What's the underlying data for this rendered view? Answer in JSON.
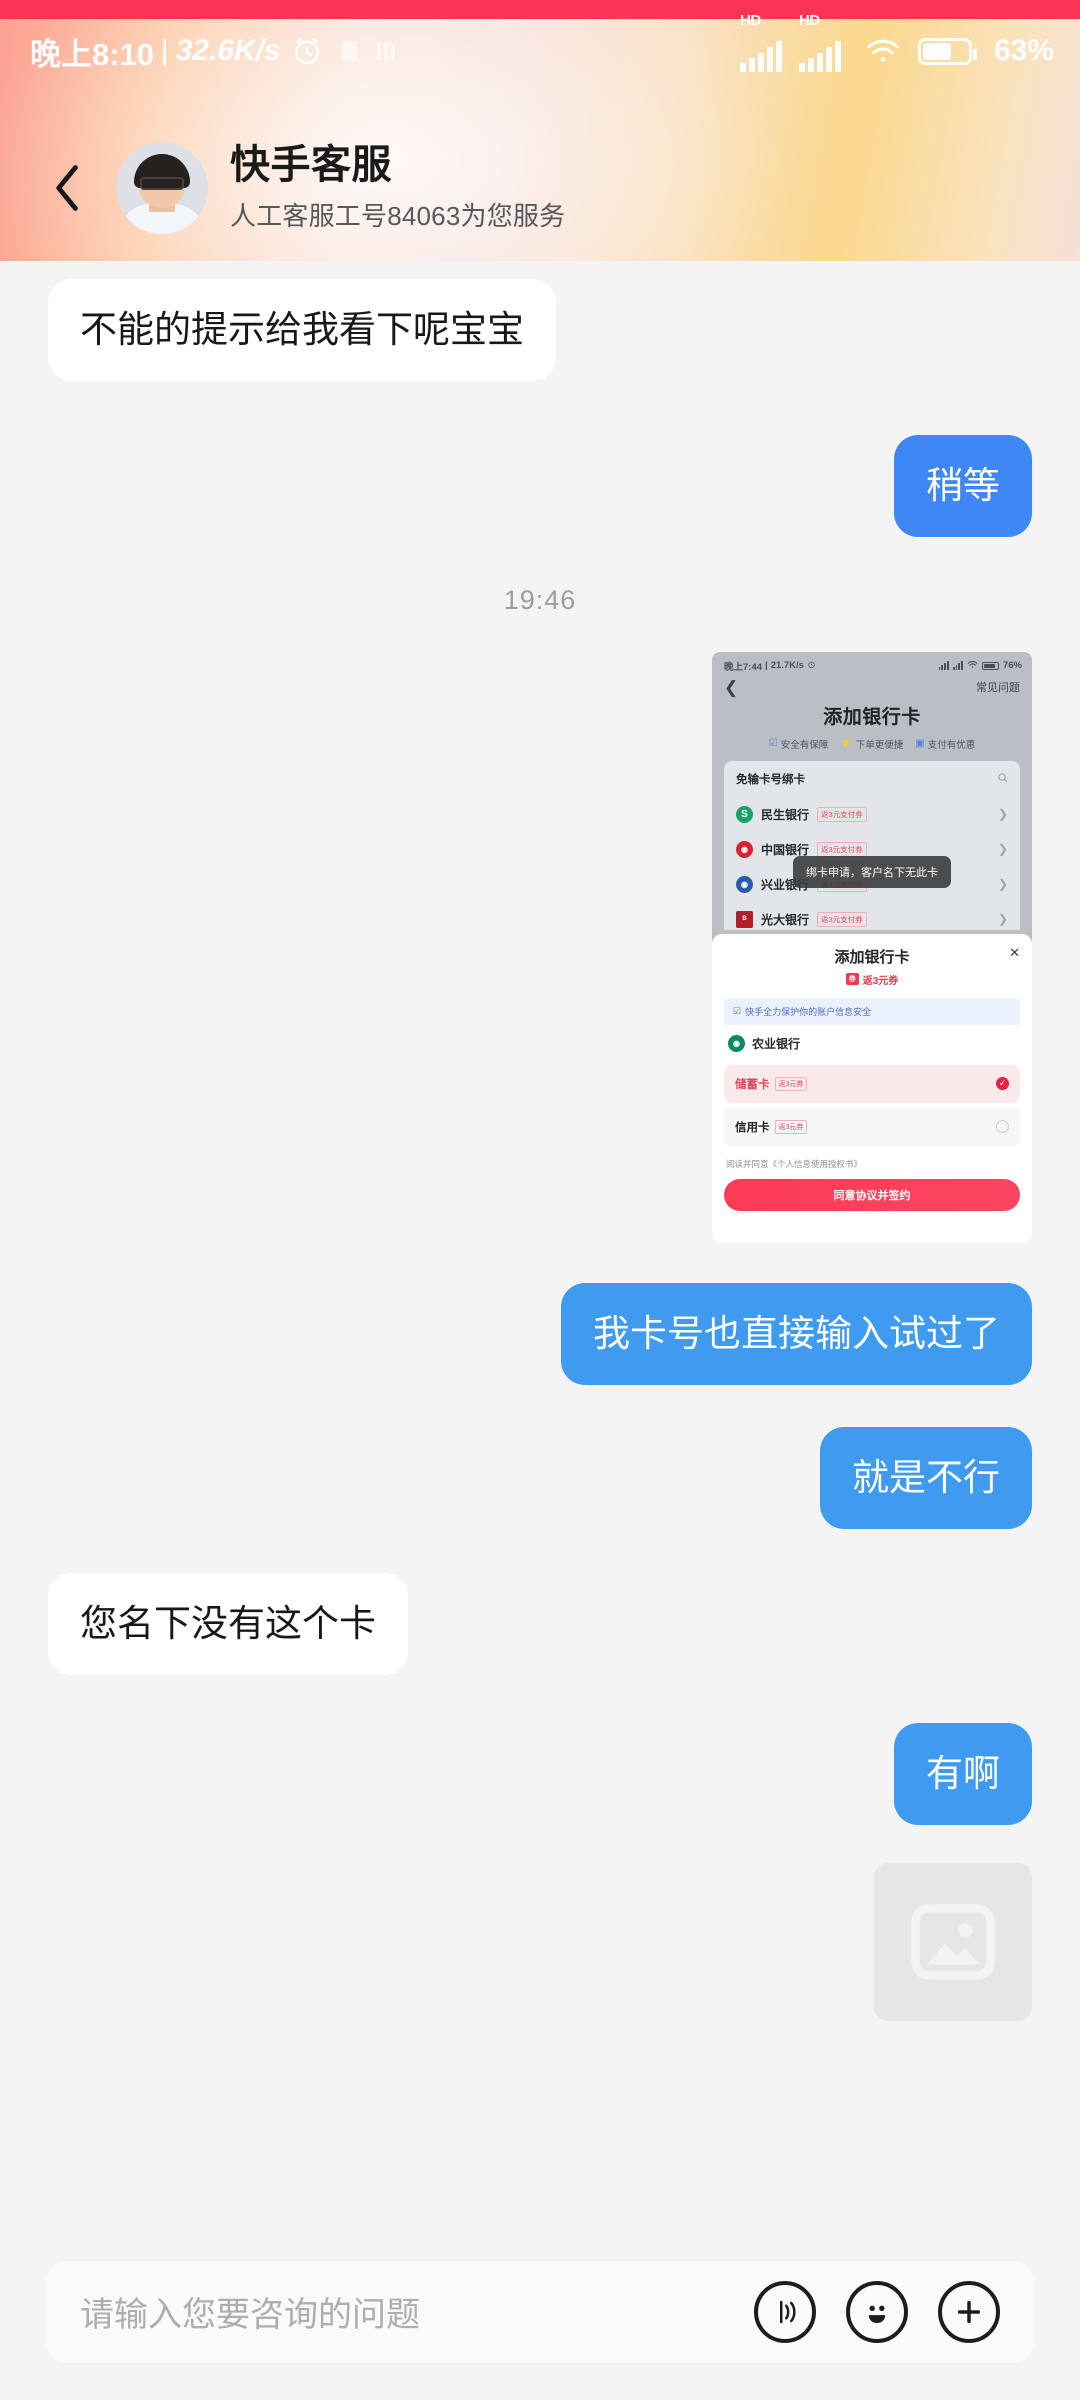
{
  "status_bar": {
    "time": "晚上8:10",
    "separator": "|",
    "net_speed": "32.6K/s",
    "alarm_icon": "alarm-clock-icon",
    "hd_label": "HD",
    "wifi_icon": "wifi-icon",
    "battery_percent": "63%"
  },
  "header": {
    "back_icon": "back-chevron-icon",
    "avatar": "agent-avatar",
    "title": "快手客服",
    "subtitle": "人工客服工号84063为您服务"
  },
  "chat": {
    "messages": [
      {
        "id": "m1",
        "side": "in",
        "type": "text",
        "text": "不能的提示给我看下呢宝宝"
      },
      {
        "id": "m2",
        "side": "out",
        "type": "text",
        "text": "稍等"
      },
      {
        "id": "ts1",
        "type": "timestamp",
        "text": "19:46"
      },
      {
        "id": "m3",
        "side": "out",
        "type": "screenshot"
      },
      {
        "id": "m4",
        "side": "out",
        "type": "text",
        "text": "我卡号也直接输入试过了"
      },
      {
        "id": "m5",
        "side": "out",
        "type": "text",
        "text": "就是不行"
      },
      {
        "id": "m6",
        "side": "in",
        "type": "text",
        "text": "您名下没有这个卡"
      },
      {
        "id": "m7",
        "side": "out",
        "type": "text",
        "text": "有啊"
      },
      {
        "id": "m8",
        "side": "out",
        "type": "image_placeholder"
      }
    ]
  },
  "screenshot_card": {
    "status_bar": {
      "time": "晚上7:44",
      "separator": "|",
      "net_speed": "21.7K/s",
      "battery_percent": "76%"
    },
    "nav": {
      "back_icon": "back-chevron-icon",
      "faq_label": "常见问题"
    },
    "title": "添加银行卡",
    "features": [
      {
        "icon": "shield-check-icon",
        "label": "安全有保障"
      },
      {
        "icon": "lightning-icon",
        "label": "下单更便捷"
      },
      {
        "icon": "coupon-icon",
        "label": "支付有优惠"
      }
    ],
    "search_label": "免输卡号绑卡",
    "search_icon": "search-icon",
    "banks": [
      {
        "name": "民生银行",
        "badge": "返3元支付券",
        "color": "#1AA06D",
        "mark": "S"
      },
      {
        "name": "中国银行",
        "badge": "返3元支付券",
        "color": "#D8232F",
        "mark": "中"
      },
      {
        "name": "兴业银行",
        "badge": "返3元支付券",
        "color": "#2B5BA8",
        "mark": "兴"
      },
      {
        "name": "光大银行",
        "badge": "返3元支付券",
        "color": "#B12028",
        "mark": "光"
      }
    ],
    "toast": "绑卡申请，客户名下无此卡",
    "sheet": {
      "close_icon": "close-icon",
      "title": "添加银行卡",
      "coupon_icon_label": "券",
      "coupon_text": "返3元券",
      "safety_icon": "shield-check-icon",
      "safety_text": "快手全力保护你的账户信息安全",
      "bank_name": "农业银行",
      "bank_color": "#0E8A63",
      "bank_mark": "农",
      "options": [
        {
          "name": "储蓄卡",
          "badge": "返3元券",
          "selected": true
        },
        {
          "name": "信用卡",
          "badge": "返3元券",
          "selected": false
        }
      ],
      "agreement": "阅读并同意《个人信息使用授权书》",
      "submit_label": "同意协议并签约"
    }
  },
  "input_bar": {
    "placeholder": "请输入您要咨询的问题",
    "voice_icon": "voice-wave-icon",
    "emoji_icon": "smiley-face-icon",
    "plus_icon": "plus-circle-icon"
  },
  "colors": {
    "accent_red": "#FB3355",
    "outgoing_bubble": "#3E87F5",
    "incoming_bubble": "#FFFFFF",
    "chat_background": "#F4F4F4",
    "cta_red": "#FC3B55"
  }
}
